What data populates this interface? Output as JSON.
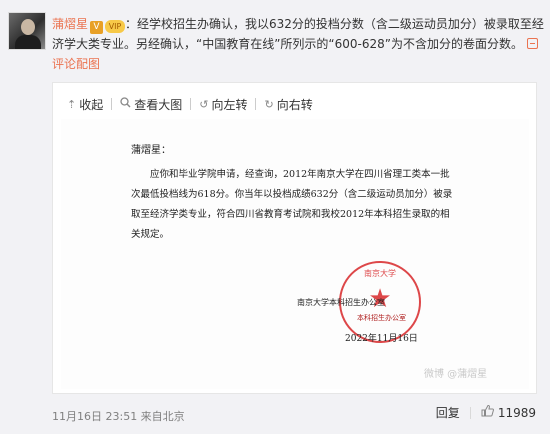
{
  "post": {
    "author": "蒲熠星",
    "v_badge": "V",
    "vip_badge": "VIP",
    "text_intro": "：经学校招生办确认，我以632分的投档分数（含二级运动员加分）被录取至经济学大类专业。另经确认，“中国教育在线”所列示的“600-628”为不含加分的卷面分数。",
    "link_label": "评论配图"
  },
  "toolbar": {
    "collapse_label": "收起",
    "view_large_label": "查看大图",
    "rotate_left_label": "向左转",
    "rotate_right_label": "向右转"
  },
  "document": {
    "salutation": "蒲熠星：",
    "paragraph": "应你和毕业学院申请，经查询，2012年南京大学在四川省理工类本一批次最低投档线为618分。你当年以投档成绩632分（含二级运动员加分）被录取至经济学类专业，符合四川省教育考试院和我校2012年本科招生录取的相关规定。",
    "sender": "南京大学本科招生办公室",
    "sender_stamp_text": "本科招生办公室",
    "seal_text": "南京大学",
    "date": "2022年11月16日",
    "watermark": "微博 @蒲熠星"
  },
  "footer": {
    "timestamp": "11月16日 23:51 来自北京",
    "reply_label": "回复",
    "like_count": "11989"
  },
  "colors": {
    "accent": "#eb7350",
    "seal_red": "#d8282a"
  },
  "icons": {
    "collapse": "arrow-up-icon",
    "view_large": "magnifier-icon",
    "rotate_left": "rotate-left-icon",
    "rotate_right": "rotate-right-icon",
    "like": "thumbs-up-icon"
  }
}
